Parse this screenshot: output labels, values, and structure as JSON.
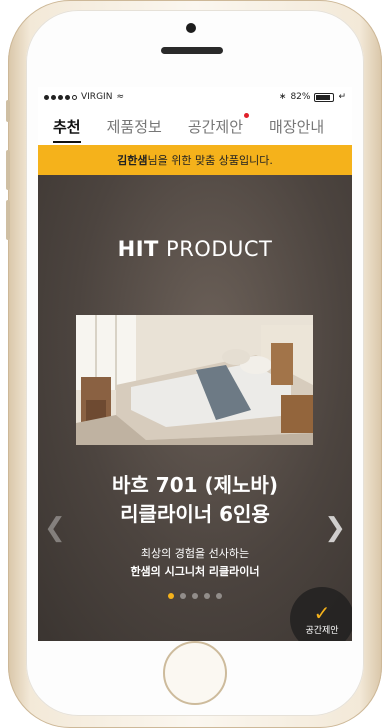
{
  "status_bar": {
    "carrier": "VIRGIN",
    "battery": "82%"
  },
  "tabs": [
    {
      "label": "추천",
      "active": true
    },
    {
      "label": "제품정보"
    },
    {
      "label": "공간제안",
      "has_badge": true
    },
    {
      "label": "매장안내"
    }
  ],
  "notice": {
    "name": "김한샘",
    "suffix": "님을 위한 맞춤 상품입니다."
  },
  "hero": {
    "title_bold": "HIT",
    "title_rest": " PRODUCT",
    "product_name_line1": "바흐 701 (제노바)",
    "product_name_line2": "리클라이너 6인용",
    "desc_line1": "최상의 경험을 선사하는",
    "desc_line2": "한샘의 시그니처 리클라이너",
    "pager_total": 5,
    "pager_active": 0
  },
  "fab": {
    "label": "공간제안"
  },
  "colors": {
    "accent": "#f5b21b",
    "badge": "#e0202a",
    "hero_bg": "#4c443f"
  }
}
